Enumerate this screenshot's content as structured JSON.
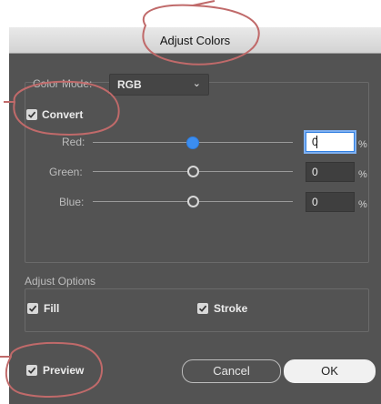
{
  "dialog": {
    "title": "Adjust Colors"
  },
  "color_mode": {
    "label": "Color Mode:",
    "selected": "RGB"
  },
  "convert": {
    "label": "Convert",
    "checked": true
  },
  "channels": [
    {
      "label": "Red:",
      "value": "0",
      "unit": "%"
    },
    {
      "label": "Green:",
      "value": "0",
      "unit": "%"
    },
    {
      "label": "Blue:",
      "value": "0",
      "unit": "%"
    }
  ],
  "adjust_options": {
    "title": "Adjust Options",
    "fill": {
      "label": "Fill",
      "checked": true
    },
    "stroke": {
      "label": "Stroke",
      "checked": true
    }
  },
  "footer": {
    "preview": {
      "label": "Preview",
      "checked": true
    },
    "cancel_label": "Cancel",
    "ok_label": "OK"
  },
  "colors": {
    "dialog_bg": "#535353",
    "accent_blue": "#3b8df0",
    "annotation": "#c06a6a"
  }
}
